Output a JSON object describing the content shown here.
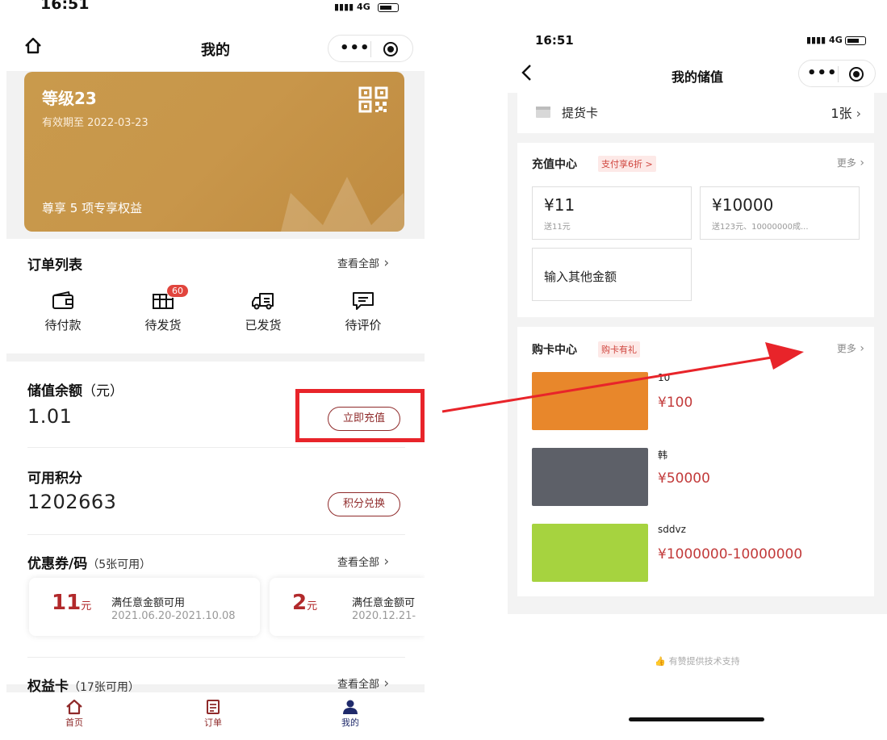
{
  "left": {
    "status": {
      "time": "16:51",
      "network": "4G"
    },
    "nav": {
      "title": "我的"
    },
    "level_card": {
      "level": "等级23",
      "valid": "有效期至 2022-03-23",
      "benefit": "尊享 5 项专享权益"
    },
    "orders": {
      "title": "订单列表",
      "see_all": "查看全部",
      "items": [
        {
          "label": "待付款",
          "icon": "wallet-icon"
        },
        {
          "label": "待发货",
          "icon": "package-icon",
          "badge": "60"
        },
        {
          "label": "已发货",
          "icon": "truck-icon"
        },
        {
          "label": "待评价",
          "icon": "comment-icon"
        }
      ]
    },
    "balance": {
      "label": "储值余额",
      "unit": "（元）",
      "value": "1.01",
      "button": "立即充值"
    },
    "points": {
      "label": "可用积分",
      "value": "1202663",
      "button": "积分兑换"
    },
    "coupons": {
      "label": "优惠券/码",
      "hint": "（5张可用）",
      "see_all": "查看全部",
      "items": [
        {
          "amount": "11",
          "unit": "元",
          "condition": "满任意金额可用",
          "dates": "2021.06.20-2021.10.08"
        },
        {
          "amount": "2",
          "unit": "元",
          "condition": "满任意金额可",
          "dates": "2020.12.21-"
        }
      ]
    },
    "benefit_cards": {
      "label": "权益卡",
      "hint": "（17张可用）",
      "see_all": "查看全部"
    },
    "tabbar": [
      {
        "label": "首页",
        "icon": "home-icon"
      },
      {
        "label": "订单",
        "icon": "order-icon"
      },
      {
        "label": "我的",
        "icon": "user-icon"
      }
    ]
  },
  "right": {
    "status": {
      "time": "16:51",
      "network": "4G"
    },
    "nav": {
      "title": "我的储值"
    },
    "pickup": {
      "label": "提货卡",
      "count": "1张"
    },
    "recharge": {
      "title": "充值中心",
      "tag": "支付享6折 >",
      "more": "更多",
      "options": [
        {
          "amount": "¥11",
          "desc": "送11元"
        },
        {
          "amount": "¥10000",
          "desc": "送123元、10000000成..."
        }
      ],
      "custom": "输入其他金额"
    },
    "card_shop": {
      "title": "购卡中心",
      "tag": "购卡有礼",
      "more": "更多",
      "items": [
        {
          "name": "10",
          "price": "¥100",
          "color": "#e8872b"
        },
        {
          "name": "韩",
          "price": "¥50000",
          "color": "#5d6068"
        },
        {
          "name": "sddvz",
          "price": "¥1000000-10000000",
          "color": "#a6d33f"
        }
      ]
    },
    "footer": {
      "text": "有赞提供技术支持"
    }
  },
  "colors": {
    "accent": "#8f2a2a",
    "highlight": "#e8242a",
    "gold": "#c8964a",
    "price": "#c23a3a"
  }
}
